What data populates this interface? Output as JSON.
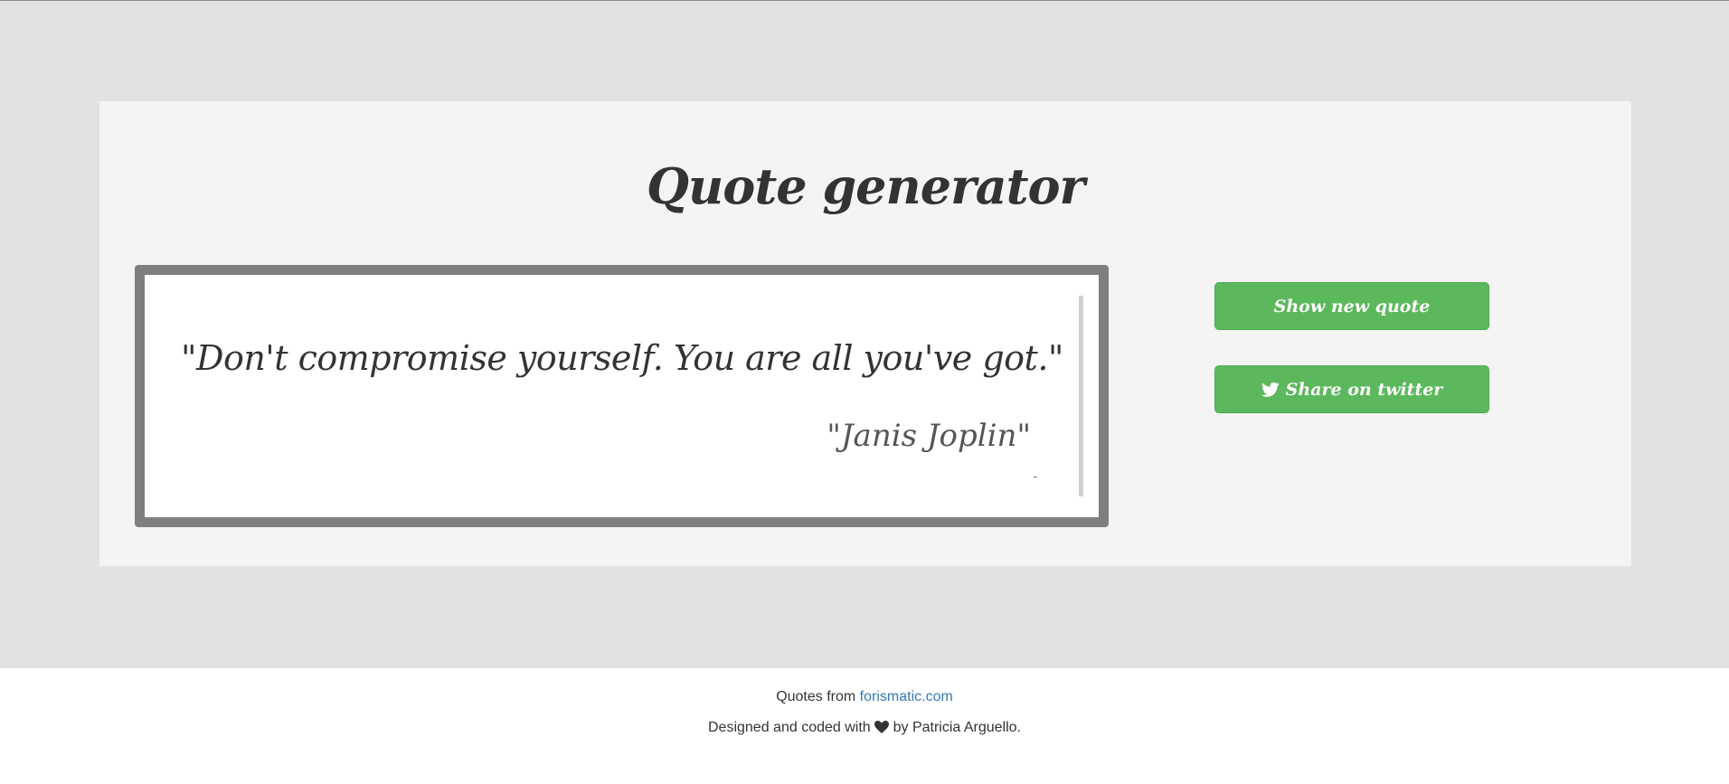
{
  "header": {
    "title": "Quote generator"
  },
  "quote": {
    "text": "\"Don't compromise yourself. You are all you've got.\"",
    "author": "\"Janis Joplin\"",
    "dash": "-"
  },
  "actions": {
    "new_quote_label": "Show new quote",
    "share_label": "Share on twitter",
    "share_icon": "twitter-icon"
  },
  "footer": {
    "source_prefix": "Quotes from",
    "source_link": "forismatic.com",
    "credit_prefix": "Designed and coded with",
    "credit_icon": "heart-icon",
    "credit_suffix": "by Patricia Arguello."
  },
  "colors": {
    "page_background": "#e2e2e2",
    "panel_background": "#f4f4f4",
    "quote_frame": "#7f7f7f",
    "button_green": "#5cb85c",
    "link_blue": "#337ab7"
  }
}
